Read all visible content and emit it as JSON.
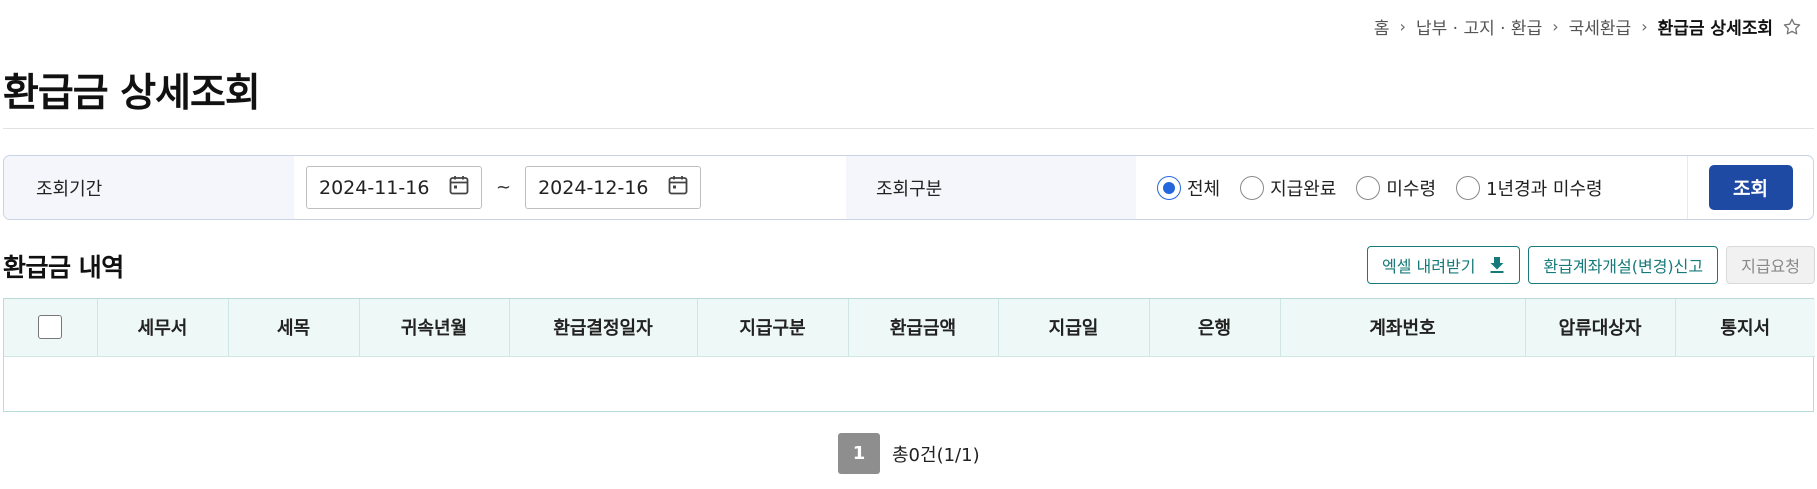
{
  "breadcrumb": {
    "items": [
      "홈",
      "납부 · 고지 · 환급",
      "국세환급",
      "환급금 상세조회"
    ],
    "separator": "›"
  },
  "page_title": "환급금 상세조회",
  "search": {
    "period_label": "조회기간",
    "start_date": "2024-11-16",
    "end_date": "2024-12-16",
    "tilde": "~",
    "type_label": "조회구분",
    "options": [
      {
        "label": "전체",
        "checked": true
      },
      {
        "label": "지급완료",
        "checked": false
      },
      {
        "label": "미수령",
        "checked": false
      },
      {
        "label": "1년경과 미수령",
        "checked": false
      }
    ],
    "button_label": "조회"
  },
  "section": {
    "title": "환급금 내역",
    "excel_button": "엑셀 내려받기",
    "account_button": "환급계좌개설(변경)신고",
    "request_button": "지급요청"
  },
  "table": {
    "headers": [
      "세무서",
      "세목",
      "귀속년월",
      "환급결정일자",
      "지급구분",
      "환급금액",
      "지급일",
      "은행",
      "계좌번호",
      "압류대상자",
      "통지서"
    ],
    "rows": []
  },
  "pagination": {
    "current_page": "1",
    "total_text": "총0건(1/1)"
  },
  "colors": {
    "primary_button": "#1f4aa3",
    "teal": "#177a7a",
    "radio_checked": "#2467dc",
    "table_header_bg": "#eef8f6"
  }
}
